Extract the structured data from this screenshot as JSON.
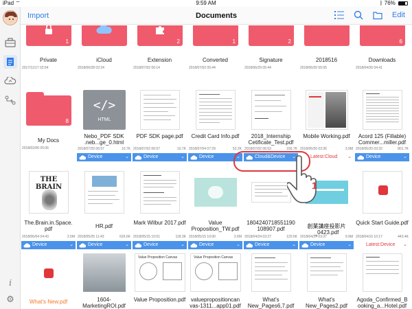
{
  "status": {
    "device": "iPad",
    "time": "9:59 AM",
    "battery": "76%",
    "battery_level": 0.76
  },
  "nav": {
    "import_label": "Import",
    "title": "Documents",
    "edit_label": "Edit"
  },
  "colors": {
    "accent": "#2f7ce6",
    "folder": "#ef5b6c",
    "device_bar": "#4a92ea",
    "latest_text": "#e0363c"
  },
  "rows": {
    "row1": [
      {
        "name": "Private",
        "date": "2017/11/17 02:54",
        "count": "1",
        "icon": "lock-icon"
      },
      {
        "name": "iCloud",
        "date": "2018/06/28 02:24",
        "count": "",
        "icon": "cloud-icon"
      },
      {
        "name": "Extension",
        "date": "2018/07/02 06:14",
        "count": "2",
        "icon": "puzzle-icon"
      },
      {
        "name": "Converted",
        "date": "2018/07/02 05:44",
        "count": "1",
        "icon": ""
      },
      {
        "name": "Signature",
        "date": "2018/06/29 05:44",
        "count": "2",
        "icon": ""
      },
      {
        "name": "2018516",
        "date": "2018/06/20 05:55",
        "count": "",
        "icon": ""
      },
      {
        "name": "Downloads",
        "date": "2018/04/26 04:41",
        "count": "6",
        "icon": ""
      }
    ],
    "row2": [
      {
        "name": "My Docs",
        "date": "2018/02/06 05:06",
        "size": "",
        "count": "8",
        "bar": ""
      },
      {
        "name": "Nebo_PDF SDK .neb...ge_0.html",
        "date": "2018/07/20 06:57",
        "size": "10.7K",
        "bar": "Device",
        "thumb_label": "HTML"
      },
      {
        "name": "PDF SDK page.pdf",
        "date": "2018/07/02 06:57",
        "size": "10.7K",
        "bar": "Device"
      },
      {
        "name": "Credit Card Info.pdf",
        "date": "2018/07/04 07:29",
        "size": "52.2K",
        "bar": "Device"
      },
      {
        "name": "2018_Internship Cetificate_Test.pdf",
        "date": "2018/07/02 06:53",
        "size": "156.7K",
        "bar": "Cloud&Device"
      },
      {
        "name": "Mobile Working.pdf",
        "date": "2018/06/30 03:36",
        "size": "3.9M",
        "bar": "Latest:Cloud"
      },
      {
        "name": "Acord 125 (Fillable) Commer...miller.pdf",
        "date": "2018/06/20 03:32",
        "size": "801.7K",
        "bar": "Device"
      }
    ],
    "row3": [
      {
        "name": "The.Brain.in.Space. pdf",
        "date": "2018/06/04 04:43",
        "size": "2.5M",
        "bar": "Device",
        "thumb_label": "THE BRAIN"
      },
      {
        "name": "HR.pdf",
        "date": "2018/05/25 11:43",
        "size": "626.6K",
        "bar": "Device"
      },
      {
        "name": "Mark Wilbur 2017.pdf",
        "date": "2018/05/15 10:01",
        "size": "118.3K",
        "bar": "Device"
      },
      {
        "name": "Value Proposition_TW.pdf",
        "date": "2018/05/15 10:00",
        "size": "2.6M",
        "bar": "Device"
      },
      {
        "name": "1804240718551190 108907.pdf",
        "date": "2018/04/24 03:27",
        "size": "120.5K",
        "bar": "Device"
      },
      {
        "name": "創業講座投影片 _0423.pdf",
        "date": "2018/04/24 03:37",
        "size": "9.9M",
        "bar": "Device"
      },
      {
        "name": "Quick Start Guide.pdf",
        "date": "2018/04/10 10:17",
        "size": "443.4K",
        "bar": "Latest:Device"
      }
    ],
    "row4": [
      {
        "name": "What's New.pdf"
      },
      {
        "name": "1604- MarketingROI.pdf"
      },
      {
        "name": "Value Proposition.pdf",
        "thumb_label": "Value Proposition Canvas"
      },
      {
        "name": "valuepropositioncan vas-1311...app01.pdf",
        "thumb_label": "Value Proposition Canvas"
      },
      {
        "name": "What's New_Pages6,7.pdf"
      },
      {
        "name": "What's New_Pages2.pdf"
      },
      {
        "name": "Agoda_Confirmed_B ooking_a...Hotel.pdf"
      }
    ]
  },
  "callout": {
    "step": "1"
  }
}
